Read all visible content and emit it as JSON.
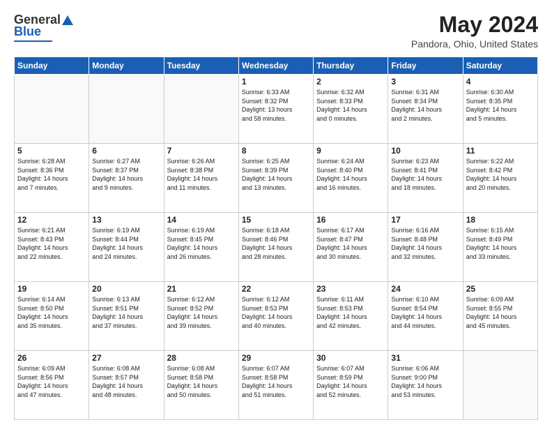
{
  "header": {
    "logo_general": "General",
    "logo_blue": "Blue",
    "title": "May 2024",
    "location": "Pandora, Ohio, United States"
  },
  "days_of_week": [
    "Sunday",
    "Monday",
    "Tuesday",
    "Wednesday",
    "Thursday",
    "Friday",
    "Saturday"
  ],
  "weeks": [
    [
      {
        "day": "",
        "info": ""
      },
      {
        "day": "",
        "info": ""
      },
      {
        "day": "",
        "info": ""
      },
      {
        "day": "1",
        "info": "Sunrise: 6:33 AM\nSunset: 8:32 PM\nDaylight: 13 hours\nand 58 minutes."
      },
      {
        "day": "2",
        "info": "Sunrise: 6:32 AM\nSunset: 8:33 PM\nDaylight: 14 hours\nand 0 minutes."
      },
      {
        "day": "3",
        "info": "Sunrise: 6:31 AM\nSunset: 8:34 PM\nDaylight: 14 hours\nand 2 minutes."
      },
      {
        "day": "4",
        "info": "Sunrise: 6:30 AM\nSunset: 8:35 PM\nDaylight: 14 hours\nand 5 minutes."
      }
    ],
    [
      {
        "day": "5",
        "info": "Sunrise: 6:28 AM\nSunset: 8:36 PM\nDaylight: 14 hours\nand 7 minutes."
      },
      {
        "day": "6",
        "info": "Sunrise: 6:27 AM\nSunset: 8:37 PM\nDaylight: 14 hours\nand 9 minutes."
      },
      {
        "day": "7",
        "info": "Sunrise: 6:26 AM\nSunset: 8:38 PM\nDaylight: 14 hours\nand 11 minutes."
      },
      {
        "day": "8",
        "info": "Sunrise: 6:25 AM\nSunset: 8:39 PM\nDaylight: 14 hours\nand 13 minutes."
      },
      {
        "day": "9",
        "info": "Sunrise: 6:24 AM\nSunset: 8:40 PM\nDaylight: 14 hours\nand 16 minutes."
      },
      {
        "day": "10",
        "info": "Sunrise: 6:23 AM\nSunset: 8:41 PM\nDaylight: 14 hours\nand 18 minutes."
      },
      {
        "day": "11",
        "info": "Sunrise: 6:22 AM\nSunset: 8:42 PM\nDaylight: 14 hours\nand 20 minutes."
      }
    ],
    [
      {
        "day": "12",
        "info": "Sunrise: 6:21 AM\nSunset: 8:43 PM\nDaylight: 14 hours\nand 22 minutes."
      },
      {
        "day": "13",
        "info": "Sunrise: 6:19 AM\nSunset: 8:44 PM\nDaylight: 14 hours\nand 24 minutes."
      },
      {
        "day": "14",
        "info": "Sunrise: 6:19 AM\nSunset: 8:45 PM\nDaylight: 14 hours\nand 26 minutes."
      },
      {
        "day": "15",
        "info": "Sunrise: 6:18 AM\nSunset: 8:46 PM\nDaylight: 14 hours\nand 28 minutes."
      },
      {
        "day": "16",
        "info": "Sunrise: 6:17 AM\nSunset: 8:47 PM\nDaylight: 14 hours\nand 30 minutes."
      },
      {
        "day": "17",
        "info": "Sunrise: 6:16 AM\nSunset: 8:48 PM\nDaylight: 14 hours\nand 32 minutes."
      },
      {
        "day": "18",
        "info": "Sunrise: 6:15 AM\nSunset: 8:49 PM\nDaylight: 14 hours\nand 33 minutes."
      }
    ],
    [
      {
        "day": "19",
        "info": "Sunrise: 6:14 AM\nSunset: 8:50 PM\nDaylight: 14 hours\nand 35 minutes."
      },
      {
        "day": "20",
        "info": "Sunrise: 6:13 AM\nSunset: 8:51 PM\nDaylight: 14 hours\nand 37 minutes."
      },
      {
        "day": "21",
        "info": "Sunrise: 6:12 AM\nSunset: 8:52 PM\nDaylight: 14 hours\nand 39 minutes."
      },
      {
        "day": "22",
        "info": "Sunrise: 6:12 AM\nSunset: 8:53 PM\nDaylight: 14 hours\nand 40 minutes."
      },
      {
        "day": "23",
        "info": "Sunrise: 6:11 AM\nSunset: 8:53 PM\nDaylight: 14 hours\nand 42 minutes."
      },
      {
        "day": "24",
        "info": "Sunrise: 6:10 AM\nSunset: 8:54 PM\nDaylight: 14 hours\nand 44 minutes."
      },
      {
        "day": "25",
        "info": "Sunrise: 6:09 AM\nSunset: 8:55 PM\nDaylight: 14 hours\nand 45 minutes."
      }
    ],
    [
      {
        "day": "26",
        "info": "Sunrise: 6:09 AM\nSunset: 8:56 PM\nDaylight: 14 hours\nand 47 minutes."
      },
      {
        "day": "27",
        "info": "Sunrise: 6:08 AM\nSunset: 8:57 PM\nDaylight: 14 hours\nand 48 minutes."
      },
      {
        "day": "28",
        "info": "Sunrise: 6:08 AM\nSunset: 8:58 PM\nDaylight: 14 hours\nand 50 minutes."
      },
      {
        "day": "29",
        "info": "Sunrise: 6:07 AM\nSunset: 8:58 PM\nDaylight: 14 hours\nand 51 minutes."
      },
      {
        "day": "30",
        "info": "Sunrise: 6:07 AM\nSunset: 8:59 PM\nDaylight: 14 hours\nand 52 minutes."
      },
      {
        "day": "31",
        "info": "Sunrise: 6:06 AM\nSunset: 9:00 PM\nDaylight: 14 hours\nand 53 minutes."
      },
      {
        "day": "",
        "info": ""
      }
    ]
  ]
}
